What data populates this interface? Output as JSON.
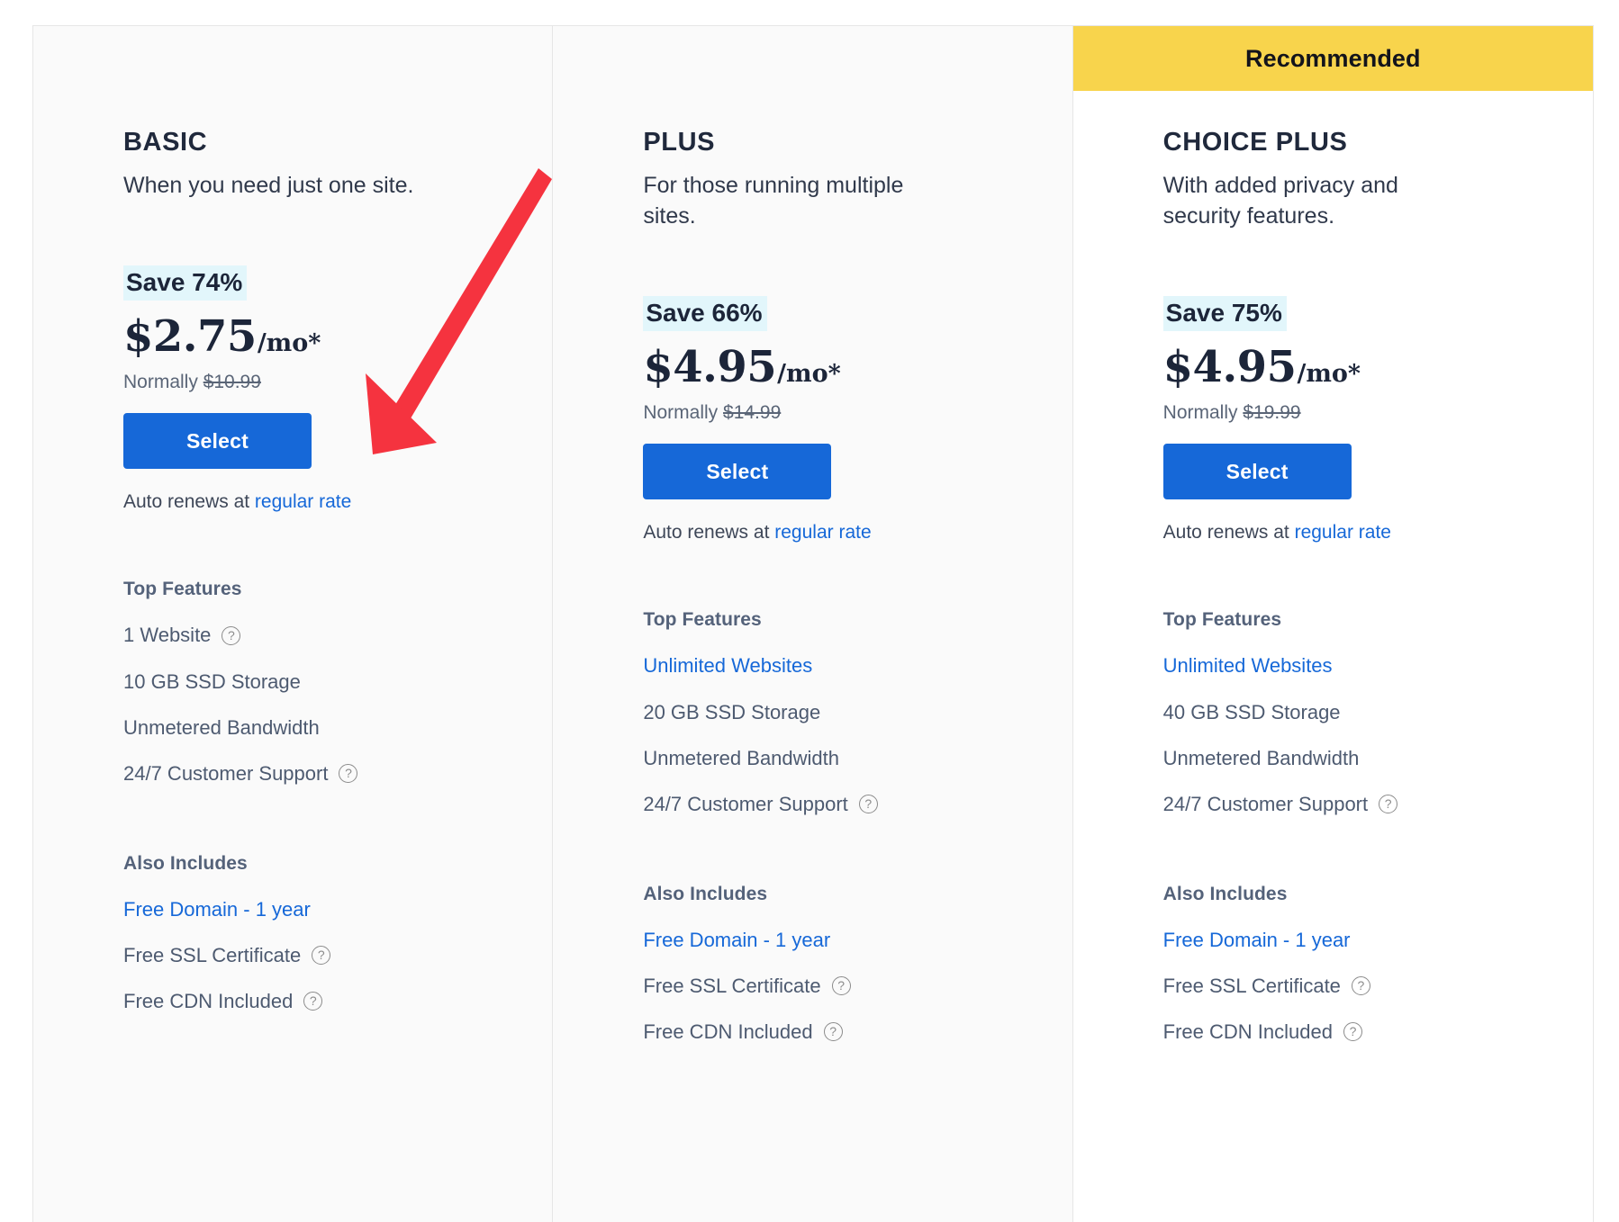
{
  "card": {
    "recommended_badge": "Recommended",
    "help_icon_glyph": "?",
    "accent_blue": "#1668d8",
    "banner_yellow": "#f8d44c",
    "save_highlight": "#e2f6fb",
    "annotation_arrow_color": "#f5333f"
  },
  "plans": [
    {
      "name": "BASIC",
      "tagline": "When you need just one site.",
      "save": "Save 74%",
      "price": "$2.75",
      "price_suffix": "/mo*",
      "normally_prefix": "Normally ",
      "normally_price": "$10.99",
      "select_label": "Select",
      "renews_prefix": "Auto renews at ",
      "renews_link": "regular rate",
      "top_features_heading": "Top Features",
      "top_features": [
        {
          "label": "1 Website",
          "help": true,
          "link": false
        },
        {
          "label": "10 GB SSD Storage",
          "help": false,
          "link": false
        },
        {
          "label": "Unmetered Bandwidth",
          "help": false,
          "link": false
        },
        {
          "label": "24/7 Customer Support",
          "help": true,
          "link": false
        }
      ],
      "also_includes_heading": "Also Includes",
      "also_includes": [
        {
          "label": "Free Domain - 1 year",
          "help": false,
          "link": true
        },
        {
          "label": "Free SSL Certificate",
          "help": true,
          "link": false
        },
        {
          "label": "Free CDN Included",
          "help": true,
          "link": false
        }
      ]
    },
    {
      "name": "PLUS",
      "tagline": "For those running multiple sites.",
      "save": "Save 66%",
      "price": "$4.95",
      "price_suffix": "/mo*",
      "normally_prefix": "Normally ",
      "normally_price": "$14.99",
      "select_label": "Select",
      "renews_prefix": "Auto renews at ",
      "renews_link": "regular rate",
      "top_features_heading": "Top Features",
      "top_features": [
        {
          "label": "Unlimited Websites",
          "help": false,
          "link": true
        },
        {
          "label": "20 GB SSD Storage",
          "help": false,
          "link": false
        },
        {
          "label": "Unmetered Bandwidth",
          "help": false,
          "link": false
        },
        {
          "label": "24/7 Customer Support",
          "help": true,
          "link": false
        }
      ],
      "also_includes_heading": "Also Includes",
      "also_includes": [
        {
          "label": "Free Domain - 1 year",
          "help": false,
          "link": true
        },
        {
          "label": "Free SSL Certificate",
          "help": true,
          "link": false
        },
        {
          "label": "Free CDN Included",
          "help": true,
          "link": false
        }
      ]
    },
    {
      "name": "CHOICE PLUS",
      "tagline": "With added privacy and security features.",
      "save": "Save 75%",
      "price": "$4.95",
      "price_suffix": "/mo*",
      "normally_prefix": "Normally ",
      "normally_price": "$19.99",
      "select_label": "Select",
      "renews_prefix": "Auto renews at ",
      "renews_link": "regular rate",
      "top_features_heading": "Top Features",
      "top_features": [
        {
          "label": "Unlimited Websites",
          "help": false,
          "link": true
        },
        {
          "label": "40 GB SSD Storage",
          "help": false,
          "link": false
        },
        {
          "label": "Unmetered Bandwidth",
          "help": false,
          "link": false
        },
        {
          "label": "24/7 Customer Support",
          "help": true,
          "link": false
        }
      ],
      "also_includes_heading": "Also Includes",
      "also_includes": [
        {
          "label": "Free Domain - 1 year",
          "help": false,
          "link": true
        },
        {
          "label": "Free SSL Certificate",
          "help": true,
          "link": false
        },
        {
          "label": "Free CDN Included",
          "help": true,
          "link": false
        }
      ]
    }
  ]
}
